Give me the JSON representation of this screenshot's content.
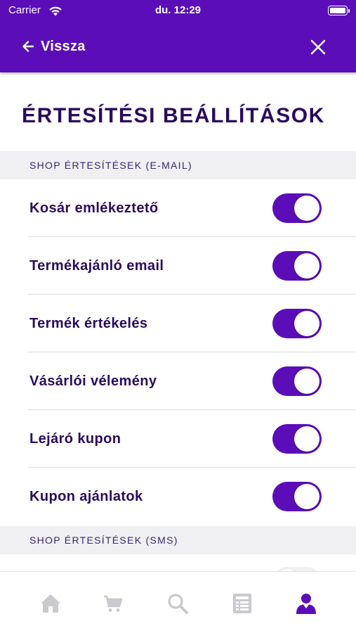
{
  "status_bar": {
    "carrier": "Carrier",
    "time": "du. 12:29"
  },
  "nav": {
    "back_label": "Vissza",
    "back_icon": "arrow-left-icon",
    "close_icon": "close-icon"
  },
  "page_title": "ÉRTESÍTÉSI BEÁLLÍTÁSOK",
  "sections": [
    {
      "title": "SHOP ÉRTESÍTÉSEK (E-MAIL)",
      "items": [
        {
          "label": "Kosár emlékeztető",
          "enabled": true
        },
        {
          "label": "Termékajánló email",
          "enabled": true
        },
        {
          "label": "Termék értékelés",
          "enabled": true
        },
        {
          "label": "Vásárlói vélemény",
          "enabled": true
        },
        {
          "label": "Lejáró kupon",
          "enabled": true
        },
        {
          "label": "Kupon ajánlatok",
          "enabled": true
        }
      ]
    },
    {
      "title": "SHOP ÉRTESÍTÉSEK (SMS)"
    }
  ],
  "tab_bar": {
    "tabs": [
      {
        "icon": "home-icon",
        "active": false
      },
      {
        "icon": "cart-icon",
        "active": false
      },
      {
        "icon": "search-icon",
        "active": false
      },
      {
        "icon": "list-icon",
        "active": false
      },
      {
        "icon": "profile-icon",
        "active": true
      }
    ]
  },
  "colors": {
    "brand": "#5b0eb8",
    "text_dark": "#2b0b5e",
    "tab_inactive": "#c9c9ce",
    "section_bg": "#f0f0f3"
  }
}
